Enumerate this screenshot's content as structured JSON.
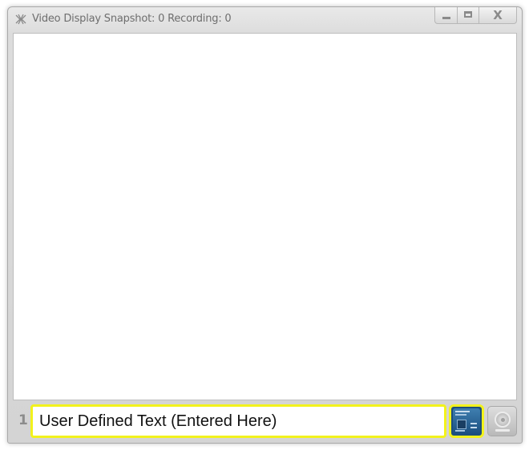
{
  "window": {
    "title": "Video Display Snapshot: 0 Recording: 0",
    "controls": {
      "minimize_icon": "minimize-icon",
      "maximize_icon": "maximize-icon",
      "close_symbol": "X"
    }
  },
  "footer": {
    "row_number": "1",
    "text_input": {
      "value": "User Defined Text (Entered Here)",
      "placeholder": ""
    },
    "buttons": [
      {
        "name": "highlighted-tile-button",
        "icon": "tile-icon"
      },
      {
        "name": "webcam-button",
        "icon": "webcam-icon"
      }
    ]
  },
  "colors": {
    "highlight": "#f2f21c",
    "tile_blue": "#1e4f7c",
    "title_text": "#6e6e6e"
  }
}
